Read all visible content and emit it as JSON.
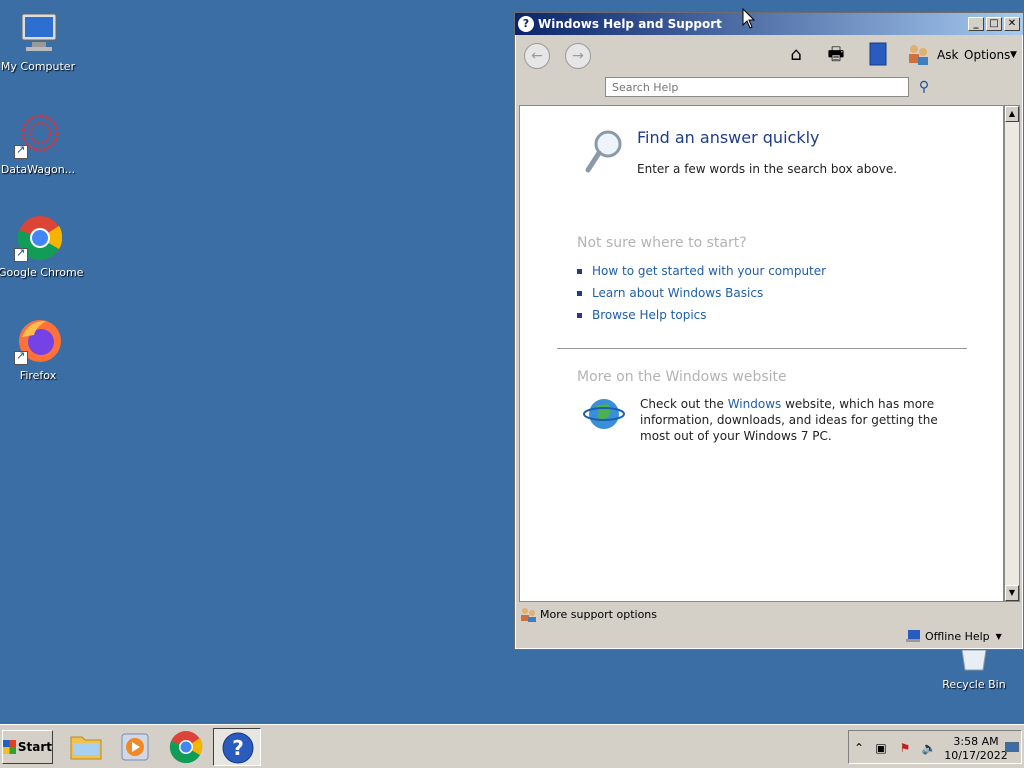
{
  "desktop": {
    "icons": [
      {
        "name": "My Computer"
      },
      {
        "name": "DataWagon..."
      },
      {
        "name": "Google Chrome"
      },
      {
        "name": "Firefox"
      },
      {
        "name": "Recycle Bin"
      }
    ]
  },
  "window": {
    "title": "Windows Help and Support",
    "toolbar": {
      "ask_label": "Ask",
      "options_label": "Options"
    },
    "search": {
      "placeholder": "Search Help"
    },
    "content": {
      "find_title": "Find an answer quickly",
      "find_sub": "Enter a few words in the search box above.",
      "not_sure_heading": "Not sure where to start?",
      "links": [
        "How to get started with your computer",
        "Learn about Windows Basics",
        "Browse Help topics"
      ],
      "more_heading": "More on the Windows website",
      "web_text_before": "Check out the ",
      "web_link": "Windows",
      "web_text_after": " website, which has more information, downloads, and ideas for getting the most out of your Windows 7 PC."
    },
    "footer": {
      "support_label": "More support options",
      "offline_label": "Offline Help"
    }
  },
  "taskbar": {
    "start_label": "Start",
    "clock_time": "3:58 AM",
    "clock_date": "10/17/2022"
  },
  "colors": {
    "desktop": "#3a6ea5",
    "link": "#1f5eab",
    "heading_gray": "#b3b3b3"
  }
}
